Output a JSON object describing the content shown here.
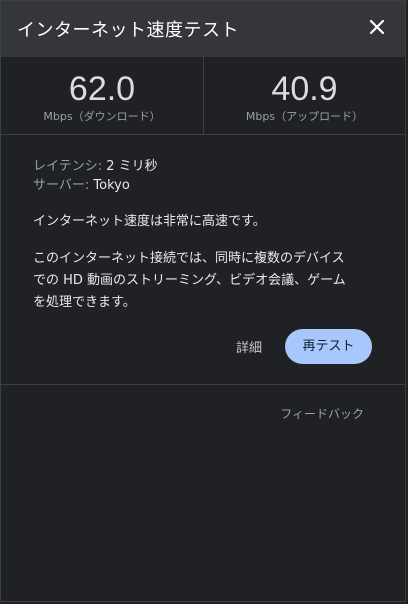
{
  "header": {
    "title": "インターネット速度テスト",
    "close_icon": "close-icon"
  },
  "metrics": {
    "download": {
      "value": "62.0",
      "unit": "Mbps（ダウンロード）"
    },
    "upload": {
      "value": "40.9",
      "unit": "Mbps（アップロード）"
    }
  },
  "details": {
    "latency_label": "レイテンシ:",
    "latency_value": "2 ミリ秒",
    "server_label": "サーバー:",
    "server_value": "Tokyo"
  },
  "status": "インターネット速度は非常に高速です。",
  "description": {
    "line1": "このインターネット接続では、同時に複数のデバイス",
    "line2": "での HD 動画のストリーミング、ビデオ会議、ゲーム",
    "line3": "を処理できます。"
  },
  "actions": {
    "details_label": "詳細",
    "retest_label": "再テスト"
  },
  "footer": {
    "feedback_label": "フィードバック"
  },
  "colors": {
    "background": "#202124",
    "header_background": "#35363a",
    "accent_button": "#a8c7fa",
    "divider": "#3c4043"
  }
}
